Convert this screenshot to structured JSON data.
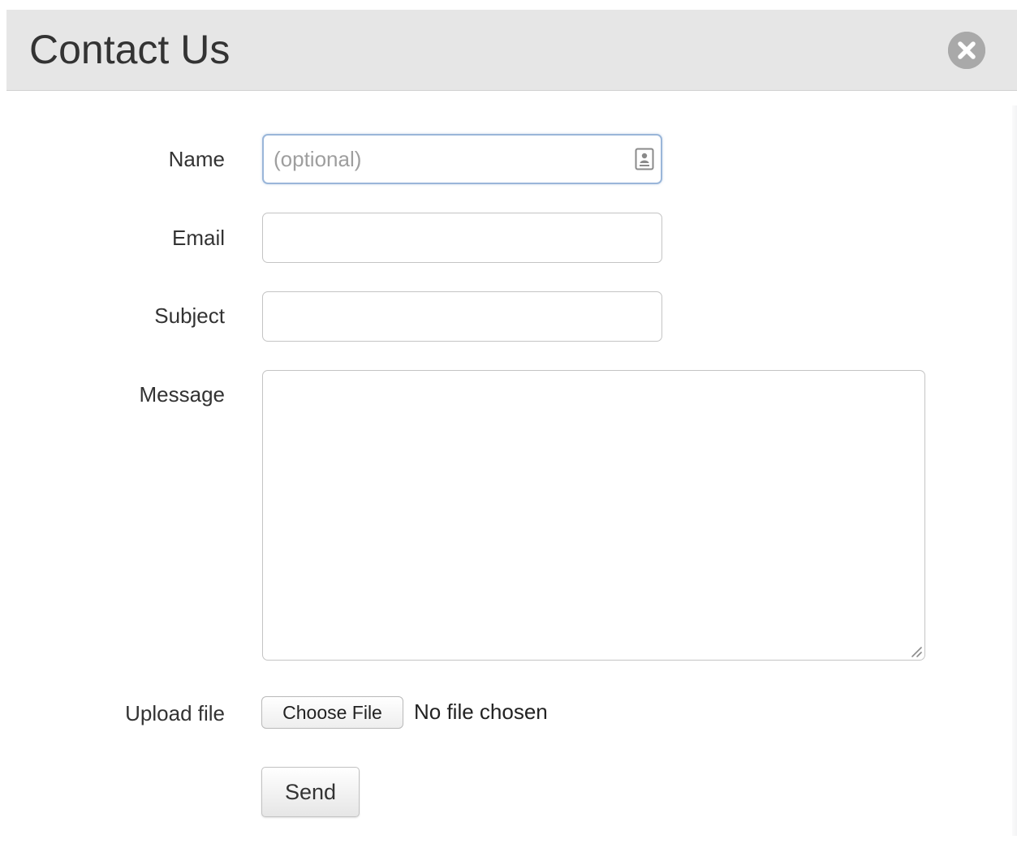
{
  "dialog": {
    "title": "Contact Us",
    "close_icon": "close-circle-icon"
  },
  "form": {
    "name": {
      "label": "Name",
      "value": "",
      "placeholder": "(optional)",
      "autofill_icon": "contact-card-icon"
    },
    "email": {
      "label": "Email",
      "value": "",
      "placeholder": ""
    },
    "subject": {
      "label": "Subject",
      "value": "",
      "placeholder": ""
    },
    "message": {
      "label": "Message",
      "value": ""
    },
    "upload": {
      "label": "Upload file",
      "button_label": "Choose File",
      "status": "No file chosen"
    },
    "send_label": "Send"
  },
  "colors": {
    "header_bg": "#e6e6e6",
    "close_icon": "#a9a9a9",
    "focus_border": "#9ab6d9",
    "text": "#333333"
  }
}
